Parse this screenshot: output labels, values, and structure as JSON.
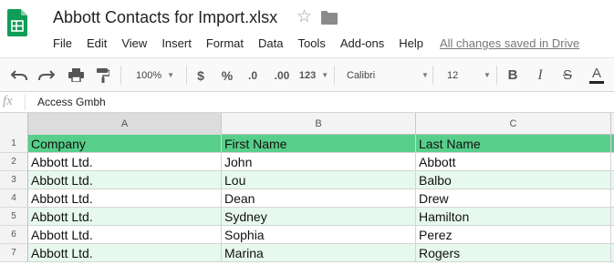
{
  "document": {
    "title": "Abbott Contacts for Import.xlsx",
    "star_icon": "star-outline-icon",
    "folder_icon": "folder-icon"
  },
  "menu": {
    "items": [
      "File",
      "Edit",
      "View",
      "Insert",
      "Format",
      "Data",
      "Tools",
      "Add-ons",
      "Help"
    ],
    "saved_status": "All changes saved in Drive"
  },
  "toolbar": {
    "undo_icon": "undo-icon",
    "redo_icon": "redo-icon",
    "print_icon": "print-icon",
    "paint_format_icon": "paint-format-icon",
    "zoom": "100%",
    "currency": "$",
    "percent": "%",
    "decrease_decimal": ".0",
    "increase_decimal": ".00",
    "number_format": "123",
    "font": "Calibri",
    "font_size": "12",
    "bold": "B",
    "italic": "I",
    "strikethrough": "S",
    "text_color": "A"
  },
  "formula_bar": {
    "fx": "fx",
    "value": "Access Gmbh"
  },
  "grid": {
    "columns": [
      "A",
      "B",
      "C"
    ],
    "active_column": "A",
    "rows": [
      {
        "num": "1",
        "cells": [
          "Company",
          "First Name",
          "Last Name"
        ]
      },
      {
        "num": "2",
        "cells": [
          "Abbott Ltd.",
          "John",
          "Abbott"
        ]
      },
      {
        "num": "3",
        "cells": [
          "Abbott Ltd.",
          "Lou",
          "Balbo"
        ]
      },
      {
        "num": "4",
        "cells": [
          "Abbott Ltd.",
          "Dean",
          "Drew"
        ]
      },
      {
        "num": "5",
        "cells": [
          "Abbott Ltd.",
          "Sydney",
          "Hamilton"
        ]
      },
      {
        "num": "6",
        "cells": [
          "Abbott Ltd.",
          "Sophia",
          "Perez"
        ]
      },
      {
        "num": "7",
        "cells": [
          "Abbott Ltd.",
          "Marina",
          "Rogers"
        ]
      }
    ]
  },
  "colors": {
    "header_fill": "#57cf8a",
    "band_fill": "#e7f9ee",
    "brand_green": "#0f9d58"
  }
}
